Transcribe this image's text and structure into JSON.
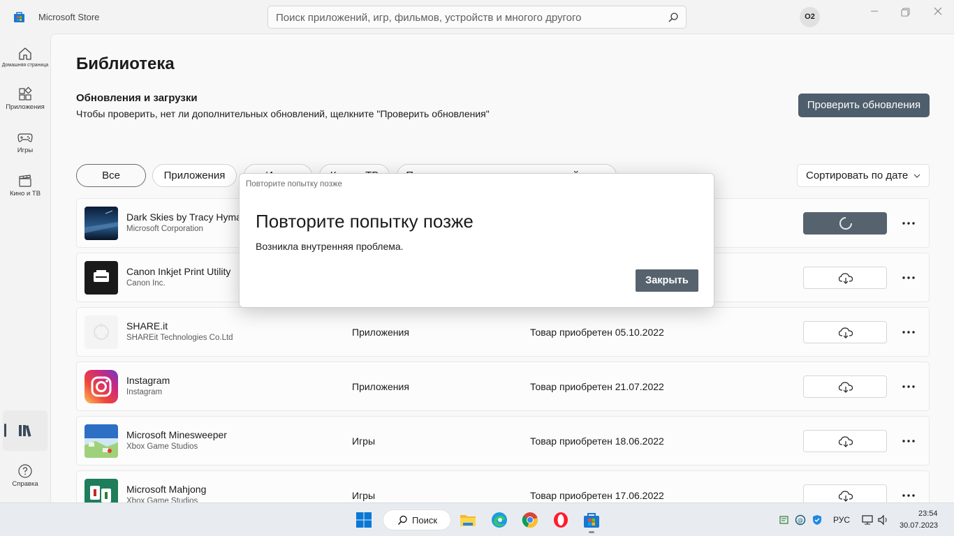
{
  "window": {
    "app_title": "Microsoft Store",
    "search_placeholder": "Поиск приложений, игр, фильмов, устройств и многого другого",
    "user_initials": "O2"
  },
  "sidebar": {
    "items": [
      {
        "label": "Домашняя страница",
        "icon": "home-icon"
      },
      {
        "label": "Приложения",
        "icon": "apps-icon"
      },
      {
        "label": "Игры",
        "icon": "gamepad-icon"
      },
      {
        "label": "Кино и ТВ",
        "icon": "movie-icon"
      },
      {
        "label": "",
        "icon": "library-icon"
      },
      {
        "label": "Справка",
        "icon": "help-icon"
      }
    ]
  },
  "library": {
    "title": "Библиотека",
    "updates_title": "Обновления и загрузки",
    "updates_desc": "Чтобы проверить, нет ли дополнительных обновлений, щелкните \"Проверить обновления\"",
    "check_updates_label": "Проверить обновления",
    "filters": [
      "Все",
      "Приложения",
      "Игры",
      "Кино и ТВ",
      "Поставляется в комплекте с устройством"
    ],
    "sort_label": "Сортировать по дате"
  },
  "apps": [
    {
      "name": "Dark Skies by Tracy Hymas",
      "publisher": "Microsoft Corporation",
      "category": "",
      "date": "",
      "status": "updating"
    },
    {
      "name": "Canon Inkjet Print Utility",
      "publisher": "Canon Inc.",
      "category": "",
      "date": "",
      "status": "download"
    },
    {
      "name": "SHARE.it",
      "publisher": "SHAREit Technologies Co.Ltd",
      "category": "Приложения",
      "date": "Товар приобретен 05.10.2022",
      "status": "download"
    },
    {
      "name": "Instagram",
      "publisher": "Instagram",
      "category": "Приложения",
      "date": "Товар приобретен 21.07.2022",
      "status": "download"
    },
    {
      "name": "Microsoft Minesweeper",
      "publisher": "Xbox Game Studios",
      "category": "Игры",
      "date": "Товар приобретен 18.06.2022",
      "status": "download"
    },
    {
      "name": "Microsoft Mahjong",
      "publisher": "Xbox Game Studios",
      "category": "Игры",
      "date": "Товар приобретен 17.06.2022",
      "status": "download"
    }
  ],
  "dialog": {
    "caption": "Повторите попытку позже",
    "heading": "Повторите попытку позже",
    "message": "Возникла внутренняя проблема.",
    "close_label": "Закрыть"
  },
  "taskbar": {
    "search_label": "Поиск",
    "language": "РУС",
    "time": "23:54",
    "date": "30.07.2023"
  },
  "colors": {
    "accent_button": "#4f5e6c",
    "dialog_button": "#56636f"
  }
}
